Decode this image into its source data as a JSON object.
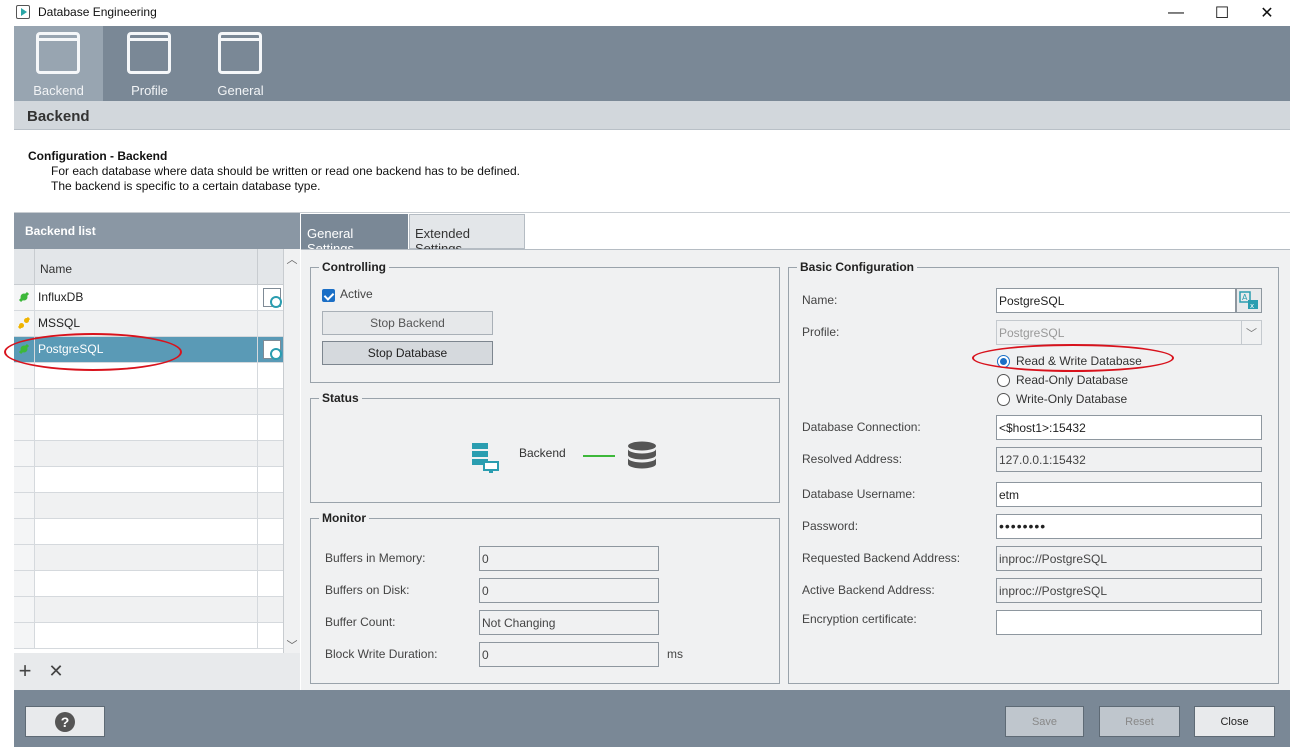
{
  "window": {
    "title": "Database Engineering",
    "controls": [
      "—",
      "☐",
      "✕"
    ]
  },
  "toolbar": {
    "items": [
      {
        "label": "Backend"
      },
      {
        "label": "Profile"
      },
      {
        "label": "General"
      }
    ]
  },
  "section": {
    "title": "Backend"
  },
  "description": {
    "title": "Configuration - Backend",
    "line1": "For each database where data should be written or read one backend has to be defined.",
    "line2": "The backend is specific to a certain database type."
  },
  "backend_list": {
    "header": "Backend list",
    "column_name": "Name",
    "rows": [
      {
        "name": "InfluxDB",
        "status_color": "#3db83a"
      },
      {
        "name": "MSSQL",
        "status_color": "#f0b400"
      },
      {
        "name": "PostgreSQL",
        "status_color": "#3db83a"
      }
    ],
    "add_icon": "+",
    "remove_icon": "✕"
  },
  "tabs": {
    "general": "General Settings",
    "extended": "Extended Settings"
  },
  "controlling": {
    "title": "Controlling",
    "active_label": "Active",
    "stop_backend": "Stop Backend",
    "stop_database": "Stop Database"
  },
  "status": {
    "title": "Status",
    "backend_label": "Backend"
  },
  "monitor": {
    "title": "Monitor",
    "buffers_in_memory_label": "Buffers in Memory:",
    "buffers_in_memory": "0",
    "buffers_on_disk_label": "Buffers on Disk:",
    "buffers_on_disk": "0",
    "buffer_count_label": "Buffer Count:",
    "buffer_count": "Not Changing",
    "block_write_label": "Block Write Duration:",
    "block_write": "0",
    "block_write_unit": "ms"
  },
  "basic": {
    "title": "Basic Configuration",
    "name_label": "Name:",
    "name": "PostgreSQL",
    "profile_label": "Profile:",
    "profile": "PostgreSQL",
    "radio_rw": "Read & Write Database",
    "radio_ro": "Read-Only Database",
    "radio_wo": "Write-Only Database",
    "db_conn_label": "Database Connection:",
    "db_conn": "<$host1>:15432",
    "resolved_label": "Resolved Address:",
    "resolved": "127.0.0.1:15432",
    "username_label": "Database Username:",
    "username": "etm",
    "password_label": "Password:",
    "password": "••••••••",
    "req_backend_label": "Requested Backend Address:",
    "req_backend": "inproc://PostgreSQL",
    "active_backend_label": "Active Backend Address:",
    "active_backend": "inproc://PostgreSQL",
    "enc_cert_label": "Encryption certificate:",
    "enc_cert": ""
  },
  "bottom": {
    "help": "?",
    "save": "Save",
    "reset": "Reset",
    "close": "Close"
  },
  "colors": {
    "accent": "#7a8896",
    "selection": "#5a9ab6",
    "highlight": "#d8121c",
    "ok": "#3db83a",
    "warn": "#f0b400"
  }
}
